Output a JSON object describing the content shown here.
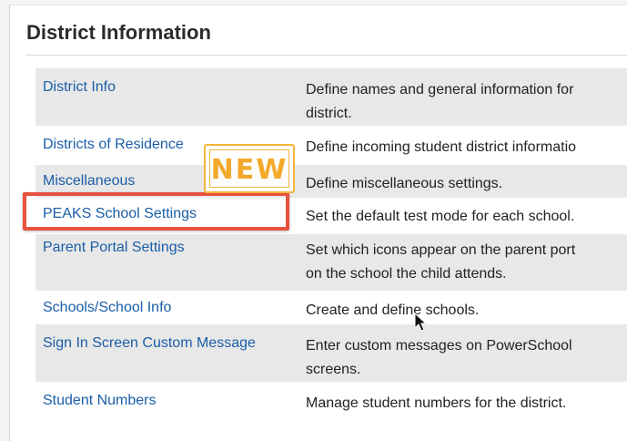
{
  "panel": {
    "title": "District Information"
  },
  "badge": {
    "label": "NEW"
  },
  "rows": [
    {
      "link": "District Info",
      "desc1": "Define names and general information for",
      "desc2": "district."
    },
    {
      "link": "Districts of Residence",
      "desc1": "Define incoming student district informatio"
    },
    {
      "link": "Miscellaneous",
      "desc1": "Define miscellaneous settings."
    },
    {
      "link": "PEAKS School Settings",
      "desc1": "Set the default test mode for each school."
    },
    {
      "link": "Parent Portal Settings",
      "desc1": "Set which icons appear on the parent port",
      "desc2": "on the school the child attends."
    },
    {
      "link": "Schools/School Info",
      "desc1": "Create and define schools."
    },
    {
      "link": "Sign In Screen Custom Message",
      "desc1": "Enter custom messages on PowerSchool",
      "desc2": "screens."
    },
    {
      "link": "Student Numbers",
      "desc1": "Manage student numbers for the district."
    }
  ],
  "colors": {
    "link": "#1a5ea8",
    "shaded_row": "#e8e8e8",
    "highlight_border": "#e8503f",
    "badge": "#f3b63b"
  },
  "icons": {
    "pointer": "mouse-pointer-icon"
  }
}
